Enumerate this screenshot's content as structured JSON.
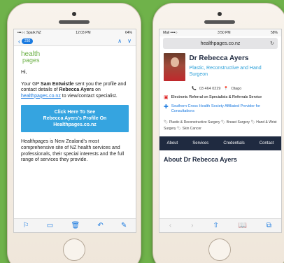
{
  "left_phone": {
    "status": {
      "carrier": "•••○○ Spark NZ",
      "time": "12:03 PM",
      "battery": "64%"
    },
    "nav": {
      "count": "230",
      "up": "∧",
      "down": "∨"
    },
    "logo": {
      "line1": "health",
      "line2": "pages"
    },
    "greeting": "Hi,",
    "intro": {
      "p1": "Your GP ",
      "gp_name": "Sam Entwistle",
      "p2": " sent you the profile and contact details of ",
      "specialist": "Rebecca Ayers",
      "p3": " on ",
      "link": "healthpages.co.nz",
      "p4": " to view/contact specialist."
    },
    "cta": {
      "line1": "Click Here To See",
      "line2": "Rebecca Ayers's Profile On",
      "line3": "Healthpages.co.nz"
    },
    "about": "Healthpages is New Zealand's most comprehensive site of NZ health services and professionals, their special interests and the full range of services they provide.",
    "toolbar": {
      "flag": "⚐",
      "folder": "▭",
      "trash": "🗑",
      "reply": "↶",
      "compose": "✎"
    }
  },
  "right_phone": {
    "status": {
      "carrier": "Mail ••••○",
      "time": "3:50 PM",
      "battery": "58%"
    },
    "url": "healthpages.co.nz",
    "reload": "↻",
    "profile": {
      "name": "Dr Rebecca Ayers",
      "title": "Plastic, Reconstructive and Hand Surgeon",
      "phone": "03 464 0229",
      "location": "Otago",
      "referral": "Electronic Referral on Specialists & Referrals Service",
      "affiliation": "Southern Cross Health Society Affiliated Provider for Consultations",
      "tags": [
        "Plastic & Reconstructive Surgery",
        "Breast Surgery",
        "Hand & Wrist Surgery",
        "Skin Cancer"
      ]
    },
    "tabs": [
      "About",
      "Services",
      "Credentials",
      "Contact"
    ],
    "about_heading": "About Dr Rebecca Ayers",
    "toolbar": {
      "back": "‹",
      "forward": "›",
      "share": "⇧",
      "bookmarks": "📖",
      "tabs": "⧉"
    }
  },
  "colors": {
    "background": "#6fb24a",
    "brand_blue": "#35a4e0",
    "navy": "#1f2a40"
  },
  "icons": {
    "phone": "📞",
    "location": "📍",
    "referral": "▣",
    "cross": "✚",
    "tag": "🏷"
  }
}
